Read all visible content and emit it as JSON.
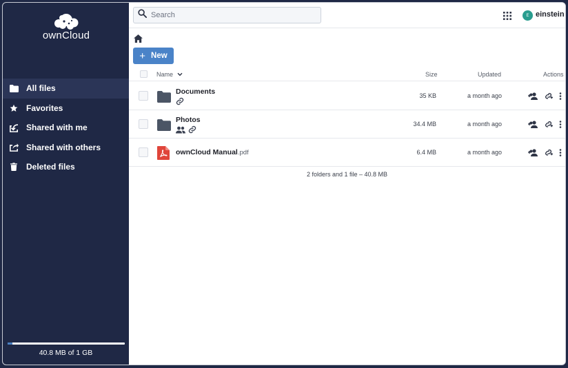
{
  "app": {
    "logo_text": "ownCloud"
  },
  "sidebar": {
    "items": [
      {
        "label": "All files",
        "icon": "folder-icon",
        "active": true
      },
      {
        "label": "Favorites",
        "icon": "star-icon",
        "active": false
      },
      {
        "label": "Shared with me",
        "icon": "share-in-icon",
        "active": false
      },
      {
        "label": "Shared with others",
        "icon": "share-out-icon",
        "active": false
      },
      {
        "label": "Deleted files",
        "icon": "trash-icon",
        "active": false
      }
    ],
    "quota": {
      "text": "40.8 MB of 1 GB",
      "used_fraction": 0.04
    }
  },
  "topbar": {
    "search_placeholder": "Search",
    "user": {
      "name": "einstein",
      "avatar_initial": "E",
      "avatar_color": "#2a9d8f"
    }
  },
  "toolbar": {
    "new_label": "New"
  },
  "table": {
    "headers": {
      "name": "Name",
      "size": "Size",
      "updated": "Updated",
      "actions": "Actions"
    },
    "rows": [
      {
        "name": "Documents",
        "ext": "",
        "type": "folder",
        "size": "35 KB",
        "updated": "a month ago",
        "indicators": [
          "link-icon"
        ]
      },
      {
        "name": "Photos",
        "ext": "",
        "type": "folder",
        "size": "34.4 MB",
        "updated": "a month ago",
        "indicators": [
          "people-icon",
          "link-icon"
        ]
      },
      {
        "name": "ownCloud Manual",
        "ext": ".pdf",
        "type": "pdf",
        "size": "6.4 MB",
        "updated": "a month ago",
        "indicators": []
      }
    ],
    "summary": "2 folders and 1 file – 40.8 MB"
  },
  "colors": {
    "sidebar_bg": "#1f2845",
    "accent": "#4a83c8",
    "folder": "#4b5565",
    "pdf": "#e0453a"
  }
}
